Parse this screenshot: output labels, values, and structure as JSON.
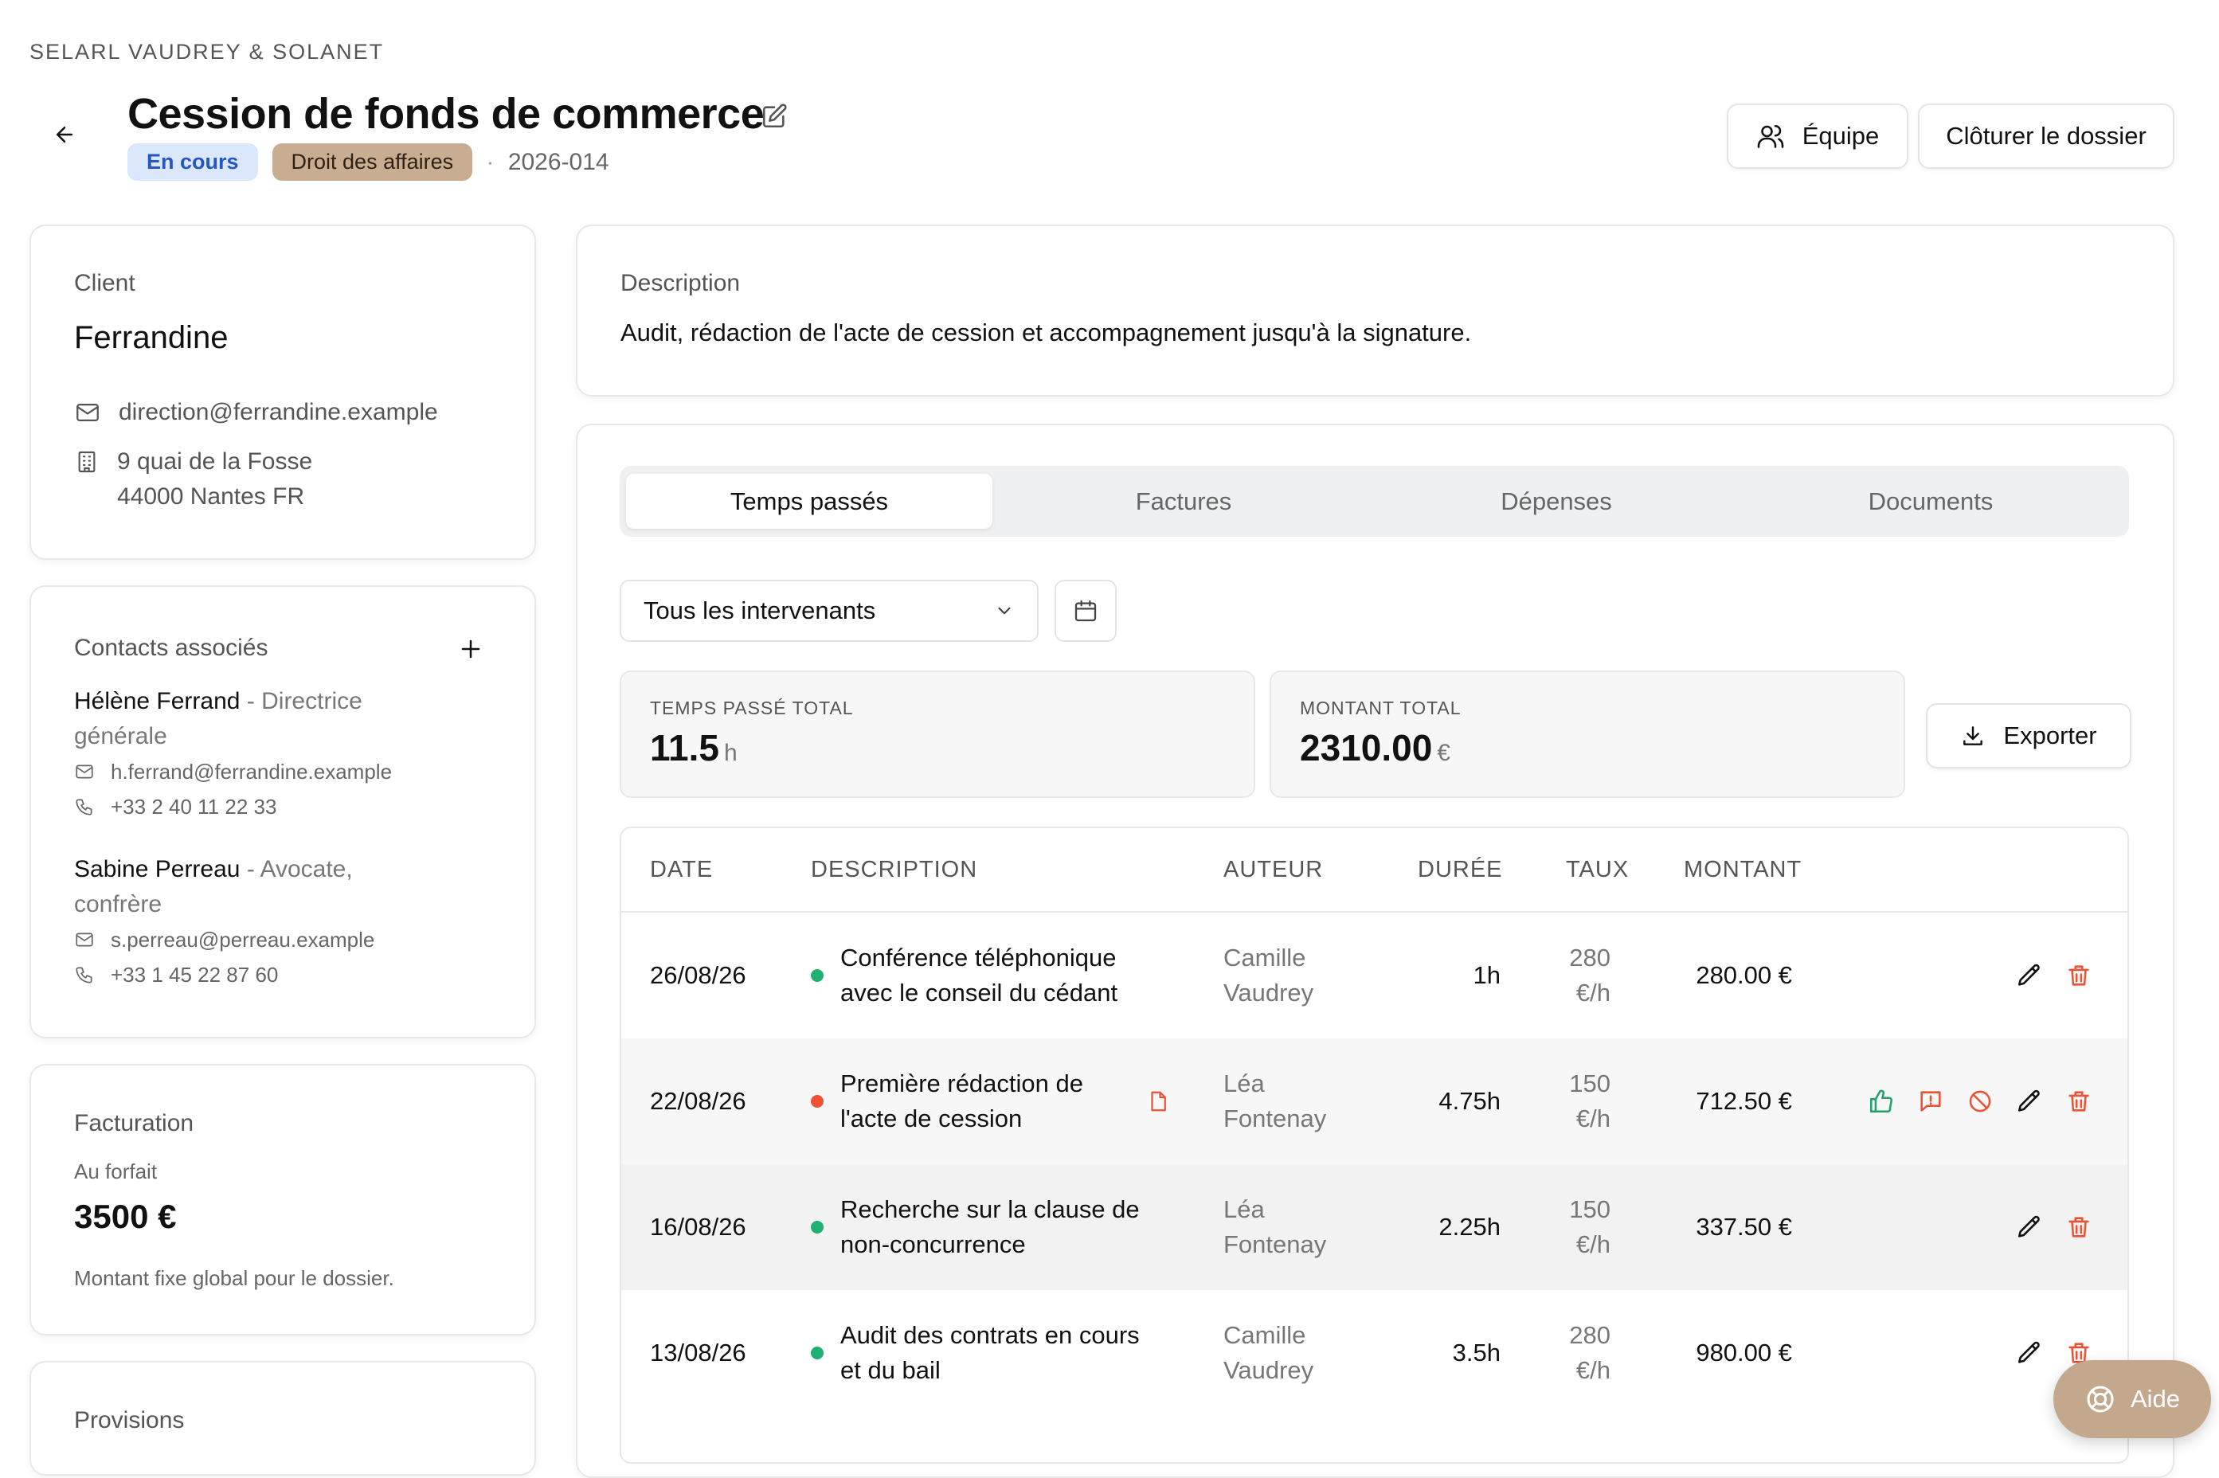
{
  "header": {
    "firm": "SELARL VAUDREY & SOLANET",
    "title": "Cession de fonds de commerce",
    "status": "En cours",
    "practice_area": "Droit des affaires",
    "separator": "·",
    "reference": "2026-014",
    "team_button": "Équipe",
    "close_button": "Clôturer le dossier",
    "icons": {
      "back": "arrow-left-icon",
      "edit": "edit-icon",
      "team": "users-icon"
    }
  },
  "client": {
    "label": "Client",
    "name": "Ferrandine",
    "email": "direction@ferrandine.example",
    "address_line1": "9 quai de la Fosse",
    "address_line2": "44000 Nantes FR"
  },
  "contacts": {
    "label": "Contacts associés",
    "add_icon": "plus-icon",
    "items": [
      {
        "name": "Hélène Ferrand",
        "role_line1": " - Directrice",
        "role_line2": "générale",
        "email": "h.ferrand@ferrandine.example",
        "phone": "+33 2 40 11 22 33"
      },
      {
        "name": "Sabine Perreau",
        "role_line1": " - Avocate,",
        "role_line2": "confrère",
        "email": "s.perreau@perreau.example",
        "phone": "+33 1 45 22 87 60"
      }
    ]
  },
  "billing": {
    "label": "Facturation",
    "mode": "Au forfait",
    "amount": "3500 €",
    "note": "Montant fixe global pour le dossier."
  },
  "provisions": {
    "label": "Provisions"
  },
  "description": {
    "label": "Description",
    "text": "Audit, rédaction de l'acte de cession et accompagnement jusqu'à la signature."
  },
  "tabs": [
    "Temps passés",
    "Factures",
    "Dépenses",
    "Documents"
  ],
  "filters": {
    "intervenant": "Tous les intervenants",
    "icons": {
      "dropdown": "chevron-down-icon",
      "calendar": "calendar-icon"
    }
  },
  "stats": {
    "time_label": "TEMPS PASSÉ TOTAL",
    "time_value": "11.5",
    "time_unit": "h",
    "amount_label": "MONTANT TOTAL",
    "amount_value": "2310.00",
    "amount_unit": "€"
  },
  "export_button": "Exporter",
  "table": {
    "headers": [
      "DATE",
      "DESCRIPTION",
      "AUTEUR",
      "DURÉE",
      "TAUX",
      "MONTANT"
    ],
    "rows": [
      {
        "date": "26/08/26",
        "status_color": "#1fb174",
        "desc_line1": "Conférence téléphonique",
        "desc_line2": "avec le conseil du cédant",
        "author_line1": "Camille",
        "author_line2": "Vaudrey",
        "duration": "1h",
        "rate_line1": "280",
        "rate_line2": "€/h",
        "amount": "280.00 €",
        "has_doc": false,
        "review_actions": false
      },
      {
        "date": "22/08/26",
        "status_color": "#ef5134",
        "desc_line1": "Première rédaction de",
        "desc_line2": "l'acte de cession",
        "author_line1": "Léa",
        "author_line2": "Fontenay",
        "duration": "4.75h",
        "rate_line1": "150",
        "rate_line2": "€/h",
        "amount": "712.50 €",
        "has_doc": true,
        "review_actions": true
      },
      {
        "date": "16/08/26",
        "status_color": "#1fb174",
        "desc_line1": "Recherche sur la clause de",
        "desc_line2": "non-concurrence",
        "author_line1": "Léa",
        "author_line2": "Fontenay",
        "duration": "2.25h",
        "rate_line1": "150",
        "rate_line2": "€/h",
        "amount": "337.50 €",
        "has_doc": false,
        "review_actions": false
      },
      {
        "date": "13/08/26",
        "status_color": "#1fb174",
        "desc_line1": "Audit des contrats en cours",
        "desc_line2": "et du bail",
        "author_line1": "Camille",
        "author_line2": "Vaudrey",
        "duration": "3.5h",
        "rate_line1": "280",
        "rate_line2": "€/h",
        "amount": "980.00 €",
        "has_doc": false,
        "review_actions": false
      }
    ]
  },
  "help_button": "Aide",
  "colors": {
    "status_badge_bg": "#dbe7fb",
    "status_badge_text": "#2456c6",
    "practice_badge_bg": "#c9ad92",
    "approve": "#1fa36a",
    "warn": "#ef5134",
    "help_bg": "#c4a88d"
  }
}
